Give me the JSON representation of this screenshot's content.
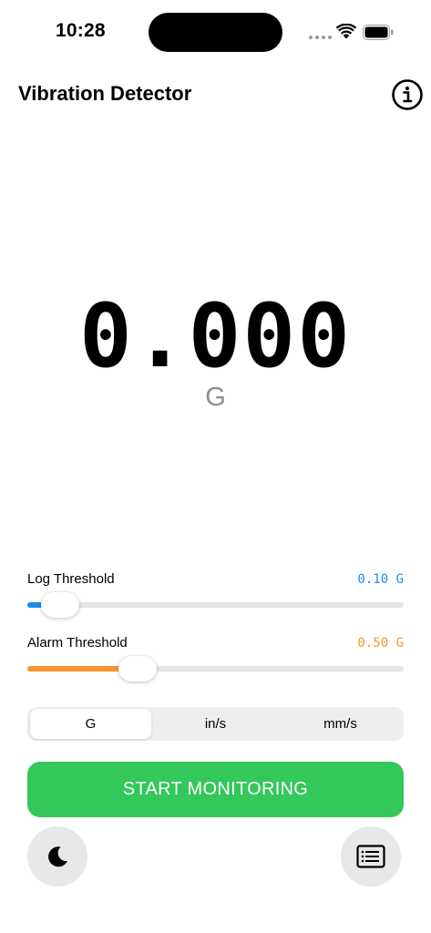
{
  "status_bar": {
    "time": "10:28",
    "icons": [
      "cellular-dots-icon",
      "wifi-icon",
      "battery-icon"
    ]
  },
  "header": {
    "title": "Vibration Detector",
    "info_icon": "info-icon"
  },
  "reading": {
    "value": "0.000",
    "unit": "G"
  },
  "log_threshold": {
    "label": "Log Threshold",
    "value_text": "0.10 G",
    "value": 0.1,
    "fraction": 0.04,
    "color": "#1a8cf0"
  },
  "alarm_threshold": {
    "label": "Alarm Threshold",
    "value_text": "0.50 G",
    "value": 0.5,
    "fraction": 0.27,
    "color": "#f7952f"
  },
  "units": {
    "options": [
      "G",
      "in/s",
      "mm/s"
    ],
    "selected": "G"
  },
  "start_button": {
    "label": "START MONITORING",
    "color": "#34c759"
  },
  "bottom_buttons": {
    "left_icon": "moon-icon",
    "right_icon": "log-list-icon"
  }
}
